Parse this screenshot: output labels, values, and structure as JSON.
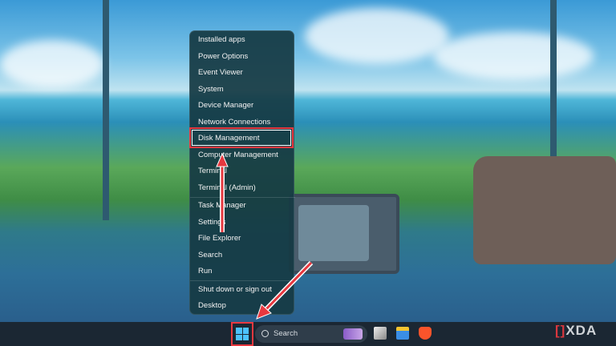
{
  "menu": {
    "items": [
      "Installed apps",
      "Power Options",
      "Event Viewer",
      "System",
      "Device Manager",
      "Network Connections",
      "Disk Management",
      "Computer Management",
      "Terminal",
      "Terminal (Admin)",
      "Task Manager",
      "Settings",
      "File Explorer",
      "Search",
      "Run",
      "Shut down or sign out",
      "Desktop"
    ],
    "highlighted": "Disk Management"
  },
  "taskbar": {
    "search_label": "Search",
    "watermark": "XDA"
  },
  "colors": {
    "highlight": "#e8383f",
    "accent": "#4cc2ff"
  }
}
